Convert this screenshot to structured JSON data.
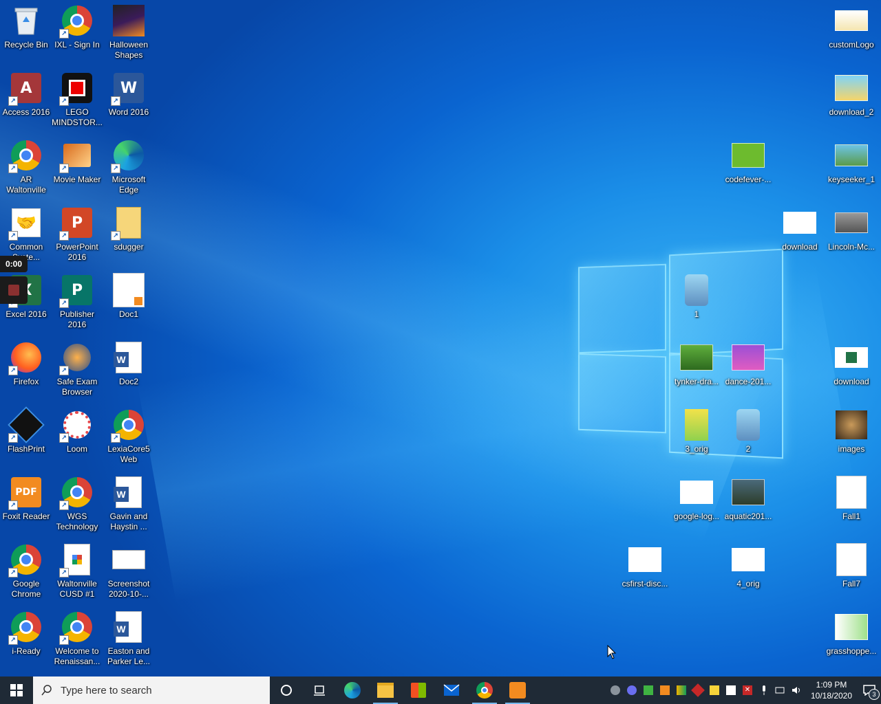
{
  "desktop": {
    "icons_left": [
      {
        "label": "Recycle Bin",
        "icon": "recycle-bin-icon"
      },
      {
        "label": "IXL - Sign In",
        "icon": "chrome-icon"
      },
      {
        "label": "Halloween Shapes",
        "icon": "halloween-shapes-icon"
      },
      {
        "label": "Access 2016",
        "icon": "access-icon"
      },
      {
        "label": "LEGO MINDSTOR...",
        "icon": "lego-mindstorms-icon"
      },
      {
        "label": "Word 2016",
        "icon": "word-icon"
      },
      {
        "label": "AR Waltonville",
        "icon": "chrome-icon"
      },
      {
        "label": "Movie Maker",
        "icon": "movie-maker-icon"
      },
      {
        "label": "Microsoft Edge",
        "icon": "edge-icon"
      },
      {
        "label": "Common Syste...",
        "icon": "handshake-icon"
      },
      {
        "label": "PowerPoint 2016",
        "icon": "powerpoint-icon"
      },
      {
        "label": "sdugger",
        "icon": "folder-icon"
      },
      {
        "label": "Excel 2016",
        "icon": "excel-icon"
      },
      {
        "label": "Publisher 2016",
        "icon": "publisher-icon"
      },
      {
        "label": "Doc1",
        "icon": "foxit-doc-icon"
      },
      {
        "label": "Firefox",
        "icon": "firefox-icon"
      },
      {
        "label": "Safe Exam Browser",
        "icon": "safe-exam-icon"
      },
      {
        "label": "Doc2",
        "icon": "word-doc-icon"
      },
      {
        "label": "FlashPrint",
        "icon": "flashprint-icon"
      },
      {
        "label": "Loom",
        "icon": "loom-icon"
      },
      {
        "label": "LexiaCore5 Web",
        "icon": "chrome-icon"
      },
      {
        "label": "Foxit Reader",
        "icon": "foxit-icon"
      },
      {
        "label": "WGS Technology",
        "icon": "chrome-icon"
      },
      {
        "label": "Gavin and Haystin ...",
        "icon": "word-doc-icon"
      },
      {
        "label": "Google Chrome",
        "icon": "chrome-icon"
      },
      {
        "label": "Waltonville CUSD #1",
        "icon": "google-doc-icon"
      },
      {
        "label": "Screenshot 2020-10-...",
        "icon": "screenshot-icon"
      },
      {
        "label": "i-Ready",
        "icon": "chrome-icon"
      },
      {
        "label": "Welcome to Renaissan...",
        "icon": "chrome-icon"
      },
      {
        "label": "Easton and Parker Le...",
        "icon": "word-doc-icon"
      }
    ],
    "icons_right": [
      {
        "label": "customLogo",
        "icon": "image-thumb-icon"
      },
      {
        "label": "download_2",
        "icon": "image-thumb-icon"
      },
      {
        "label": "codefever-...",
        "icon": "image-thumb-icon"
      },
      {
        "label": "keyseeker_1",
        "icon": "image-thumb-icon"
      },
      {
        "label": "download",
        "icon": "image-thumb-icon"
      },
      {
        "label": "Lincoln-Mc...",
        "icon": "image-thumb-icon"
      },
      {
        "label": "1",
        "icon": "robot-thumb-icon"
      },
      {
        "label": "tynker-dra...",
        "icon": "image-thumb-icon"
      },
      {
        "label": "dance-201...",
        "icon": "image-thumb-icon"
      },
      {
        "label": "download",
        "icon": "excel-thumb-icon"
      },
      {
        "label": "3_orig",
        "icon": "image-thumb-icon"
      },
      {
        "label": "2",
        "icon": "robot-thumb-icon"
      },
      {
        "label": "images",
        "icon": "image-thumb-icon"
      },
      {
        "label": "google-log...",
        "icon": "image-thumb-icon"
      },
      {
        "label": "aquatic201...",
        "icon": "image-thumb-icon"
      },
      {
        "label": "Fall1",
        "icon": "image-thumb-icon"
      },
      {
        "label": "csfirst-disc...",
        "icon": "image-thumb-icon"
      },
      {
        "label": "4_orig",
        "icon": "image-thumb-icon"
      },
      {
        "label": "Fall7",
        "icon": "image-thumb-icon"
      },
      {
        "label": "grasshoppe...",
        "icon": "image-thumb-icon"
      }
    ]
  },
  "recorder": {
    "timer": "0:00"
  },
  "taskbar": {
    "search_placeholder": "Type here to search",
    "pinned": [
      "cortana-icon",
      "task-view-icon",
      "edge-icon",
      "file-explorer-icon",
      "store-icon",
      "mail-icon",
      "chrome-icon",
      "foxit-icon"
    ],
    "clock_time": "1:09 PM",
    "clock_date": "10/18/2020",
    "notification_count": "3"
  },
  "colors": {
    "accent": "#0a64d0",
    "taskbar": "#1f2a36"
  }
}
